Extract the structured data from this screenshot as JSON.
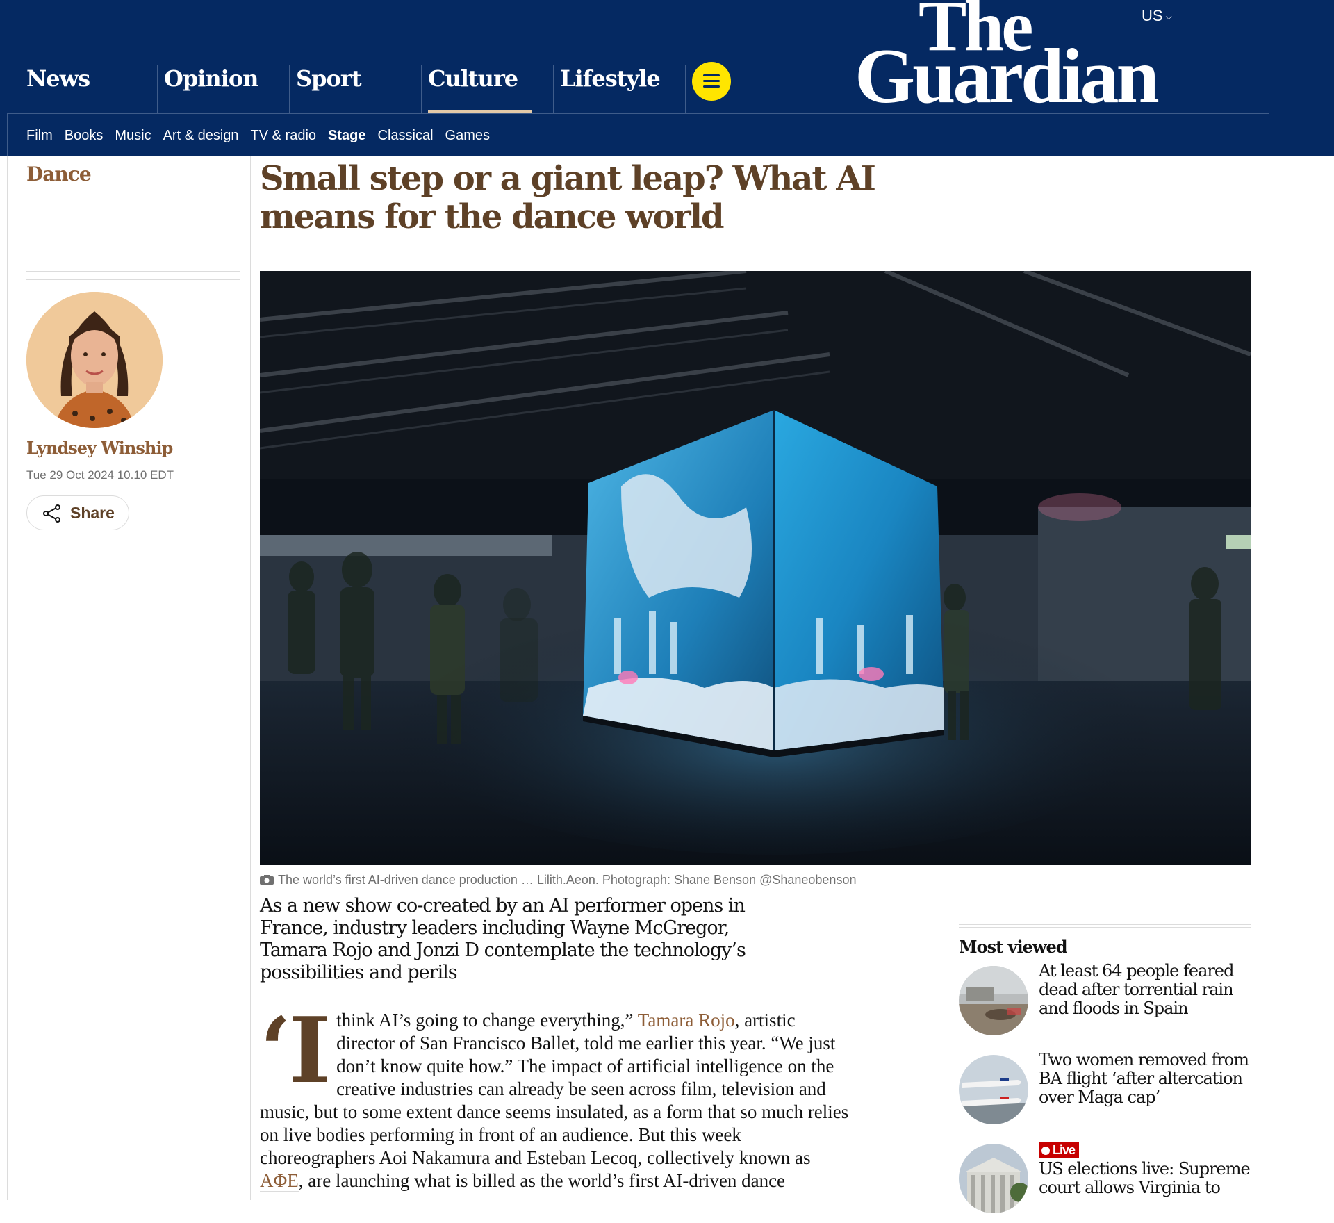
{
  "header": {
    "edition": "US",
    "logo_line1": "The",
    "logo_line2": "Guardian",
    "pillars": [
      "News",
      "Opinion",
      "Sport",
      "Culture",
      "Lifestyle"
    ],
    "subnav": [
      "Film",
      "Books",
      "Music",
      "Art & design",
      "TV & radio",
      "Stage",
      "Classical",
      "Games"
    ],
    "active_pillar": "Culture",
    "active_subnav": "Stage"
  },
  "article": {
    "section": "Dance",
    "headline": "Small step or a giant leap? What AI means for the dance world",
    "author": "Lyndsey Winship",
    "date": "Tue 29 Oct 2024 10.10 EDT",
    "share_label": "Share",
    "caption": "The world’s first AI-driven dance production … Lilith.Aeon. Photograph: Shane Benson @Shaneobenson",
    "standfirst": "As a new show co-created by an AI performer opens in France, industry leaders including Wayne McGregor, Tamara Rojo and Jonzi D contemplate the technology’s possibilities and perils",
    "body": {
      "dropcap": "‘I",
      "part1": " think AI’s going to change everything,” ",
      "link1": "Tamara Rojo",
      "part2": ", artistic director of San Francisco Ballet, told me earlier this year. “We just don’t know quite how.” The impact of artificial intelligence on the creative industries can already be seen across film, television and music, but to some extent dance seems insulated, as a form that so much relies on live bodies performing in front of an audience. But this week choreographers Aoi Nakamura and Esteban Lecoq, collectively known as ",
      "link2": "AΦE",
      "part3": ", are launching what is billed as the world’s first AI-driven dance"
    }
  },
  "most_viewed": {
    "title": "Most viewed",
    "live_label": "Live",
    "items": [
      {
        "headline": "At least 64 people feared dead after torrential rain and floods in Spain"
      },
      {
        "headline": "Two women removed from BA flight ‘after altercation over Maga cap’"
      },
      {
        "headline": "US elections live: Supreme court allows Virginia to"
      }
    ]
  },
  "colors": {
    "masthead": "#052962",
    "menu_button": "#ffe500",
    "culture_accent": "#8d5d37",
    "headline": "#5e4127",
    "live": "#c70000"
  }
}
